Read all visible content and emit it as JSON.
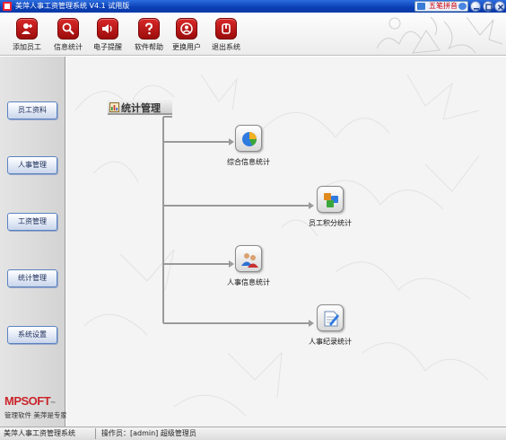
{
  "window": {
    "title": "美萍人事工资管理系统 V4.1 试用版",
    "ime_label": "五笔拼音"
  },
  "toolbar": {
    "items": [
      {
        "label": "添加员工",
        "icon": "add-user-icon"
      },
      {
        "label": "信息统计",
        "icon": "search-stats-icon"
      },
      {
        "label": "电子提醒",
        "icon": "speaker-icon"
      },
      {
        "label": "软件帮助",
        "icon": "help-icon"
      },
      {
        "label": "更换用户",
        "icon": "switch-user-icon"
      },
      {
        "label": "退出系统",
        "icon": "power-icon"
      }
    ]
  },
  "sidebar": {
    "items": [
      {
        "label": "员工资料"
      },
      {
        "label": "人事管理"
      },
      {
        "label": "工资管理"
      },
      {
        "label": "统计管理"
      },
      {
        "label": "系统设置"
      }
    ],
    "logo_text": "MPSOFT",
    "logo_tm": "™",
    "slogan": "管理软件 美萍是专家"
  },
  "main": {
    "module_title": "统计管理",
    "nodes": [
      {
        "label": "综合信息统计",
        "icon": "pie-chart-icon"
      },
      {
        "label": "员工积分统计",
        "icon": "cubes-icon"
      },
      {
        "label": "人事信息统计",
        "icon": "people-icon"
      },
      {
        "label": "人事纪录统计",
        "icon": "pen-document-icon"
      }
    ]
  },
  "status": {
    "left": "美萍人事工资管理系统",
    "operator": "操作员：[admin] 超级管理员"
  },
  "colors": {
    "titlebar": "#0a3fb4",
    "toolbar_icon": "#c41a1a",
    "sidebar_button_border": "#5b82c2"
  }
}
